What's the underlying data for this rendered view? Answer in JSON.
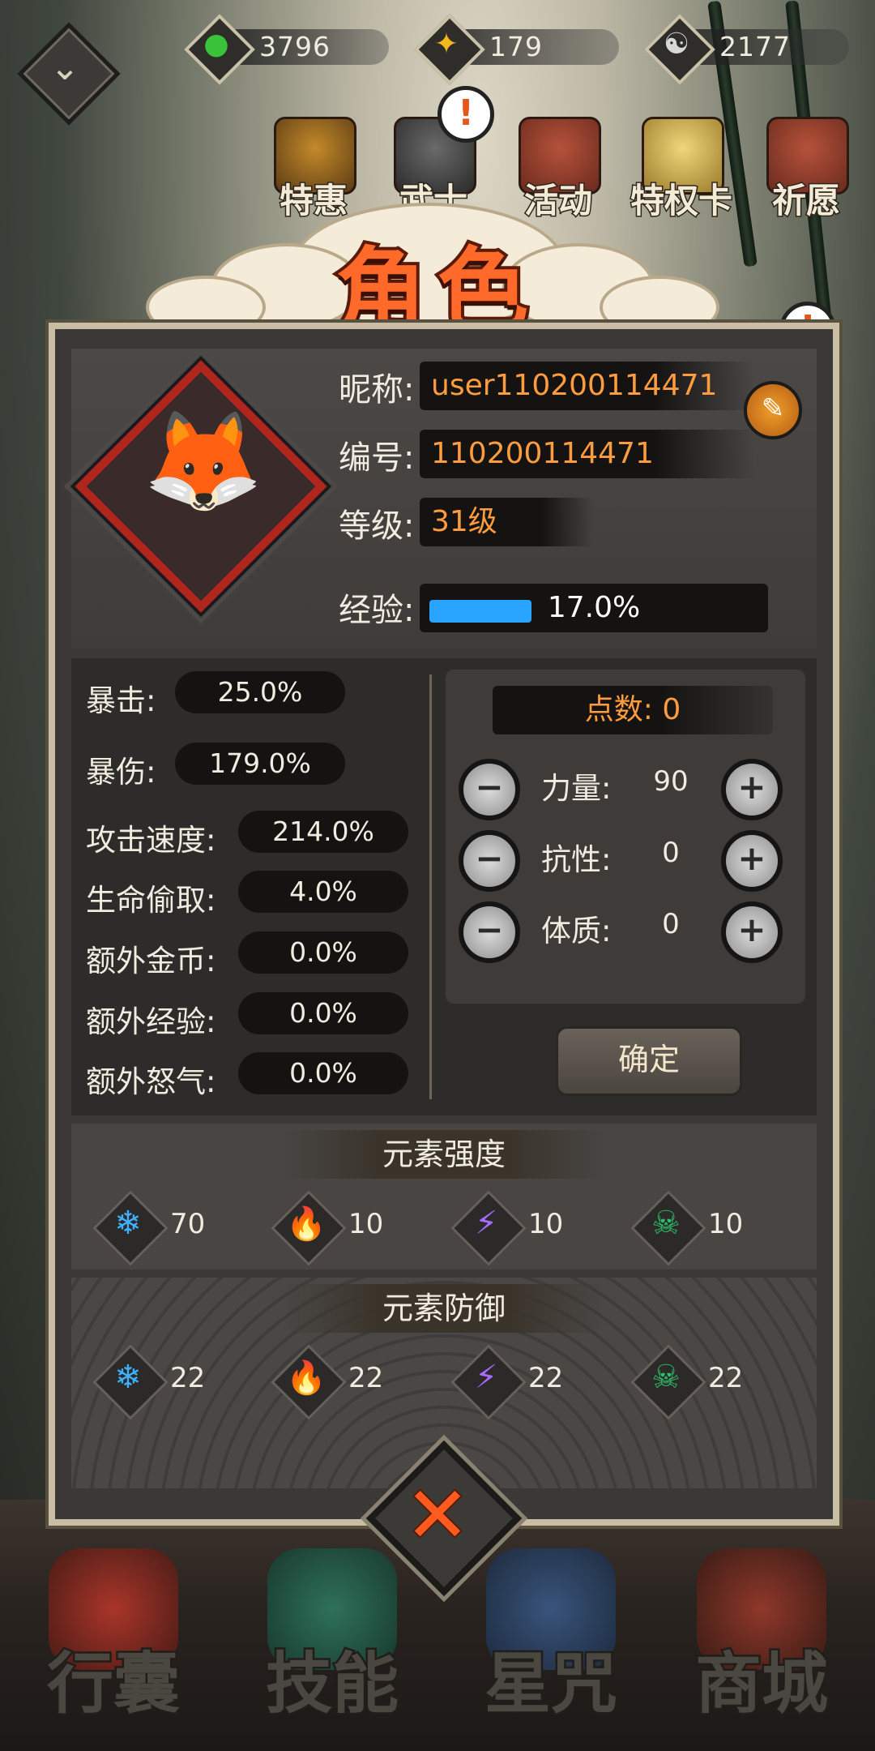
{
  "resources": [
    {
      "icon": "green-flame-icon",
      "value": "3796",
      "color": "#39c23a"
    },
    {
      "icon": "gold-coin-icon",
      "value": "179",
      "color": "#f2b71d"
    },
    {
      "icon": "yin-yang-icon",
      "value": "2177",
      "color": "#d8d8d8"
    }
  ],
  "top_menu": [
    {
      "icon": "treasure-chest-icon",
      "label": "特惠"
    },
    {
      "icon": "warrior-helmet-icon",
      "label": "武士"
    },
    {
      "icon": "drum-icon",
      "label": "活动"
    },
    {
      "icon": "privilege-card-icon",
      "label": "特权卡"
    },
    {
      "icon": "shrine-gate-icon",
      "label": "祈愿"
    }
  ],
  "title": "角色",
  "profile": {
    "nickname_label": "昵称:",
    "nickname": "user110200114471",
    "id_label": "编号:",
    "id": "110200114471",
    "level_label": "等级:",
    "level": "31级",
    "exp_label": "经验:",
    "exp_text": "17.0%",
    "exp_fraction": 0.17
  },
  "stats": [
    {
      "label": "暴击:",
      "value": "25.0%"
    },
    {
      "label": "暴伤:",
      "value": "179.0%"
    },
    {
      "label": "攻击速度:",
      "value": "214.0%"
    },
    {
      "label": "生命偷取:",
      "value": "4.0%"
    },
    {
      "label": "额外金币:",
      "value": "0.0%"
    },
    {
      "label": "额外经验:",
      "value": "0.0%"
    },
    {
      "label": "额外怒气:",
      "value": "0.0%"
    }
  ],
  "points": {
    "label": "点数: 0",
    "attributes": [
      {
        "label": "力量:",
        "value": "90"
      },
      {
        "label": "抗性:",
        "value": "0"
      },
      {
        "label": "体质:",
        "value": "0"
      }
    ],
    "confirm": "确定",
    "minus": "−",
    "plus": "+"
  },
  "element_strength": {
    "title": "元素强度",
    "items": [
      {
        "icon": "ice-icon",
        "glyph": "❄",
        "color": "#3fb1ff",
        "value": "70"
      },
      {
        "icon": "fire-icon",
        "glyph": "🔥",
        "color": "#ff7a1c",
        "value": "10"
      },
      {
        "icon": "lightning-icon",
        "glyph": "⚡",
        "color": "#a96bff",
        "value": "10"
      },
      {
        "icon": "poison-skull-icon",
        "glyph": "☠",
        "color": "#2ec06b",
        "value": "10"
      }
    ]
  },
  "element_defense": {
    "title": "元素防御",
    "items": [
      {
        "icon": "ice-icon",
        "glyph": "❄",
        "color": "#3fb1ff",
        "value": "22"
      },
      {
        "icon": "fire-icon",
        "glyph": "🔥",
        "color": "#ff7a1c",
        "value": "22"
      },
      {
        "icon": "lightning-icon",
        "glyph": "⚡",
        "color": "#a96bff",
        "value": "22"
      },
      {
        "icon": "poison-skull-icon",
        "glyph": "☠",
        "color": "#2ec06b",
        "value": "22"
      }
    ]
  },
  "bottom_nav": [
    {
      "icon": "bag-icon",
      "label": "行囊"
    },
    {
      "icon": "serpent-icon",
      "label": "技能"
    },
    {
      "icon": "star-map-icon",
      "label": "星咒"
    },
    {
      "icon": "shop-icon",
      "label": "商城"
    }
  ]
}
